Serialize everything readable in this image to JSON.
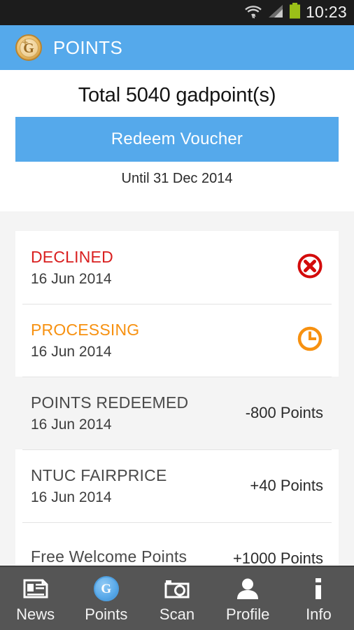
{
  "statusbar": {
    "time": "10:23",
    "icons": [
      "wifi-icon",
      "cellular-signal-icon",
      "battery-icon"
    ]
  },
  "appbar": {
    "logo_icon": "gadpoint-coin-logo",
    "logo_letter": "G",
    "title": "POINTS",
    "background_color": "#55a9eb"
  },
  "summary": {
    "total_label": "Total 5040 gadpoint(s)",
    "redeem_button_label": "Redeem Voucher",
    "validity_label": "Until 31 Dec 2014"
  },
  "transactions": [
    {
      "title": "DECLINED",
      "date": "16 Jun 2014",
      "amount": "",
      "status": "declined",
      "icon": "circle-x-icon",
      "icon_color": "#d30b0b",
      "title_color": "#d91f1f",
      "pressed": false
    },
    {
      "title": "PROCESSING",
      "date": "16 Jun 2014",
      "amount": "",
      "status": "processing",
      "icon": "clock-icon",
      "icon_color": "#f79110",
      "title_color": "#f79110",
      "pressed": false
    },
    {
      "title": "POINTS REDEEMED",
      "date": "16 Jun 2014",
      "amount": "-800 Points",
      "status": "redeemed",
      "icon": "",
      "icon_color": "",
      "title_color": "#4a4a4a",
      "pressed": true
    },
    {
      "title": "NTUC FAIRPRICE",
      "date": "16 Jun 2014",
      "amount": "+40 Points",
      "status": "earned",
      "icon": "",
      "icon_color": "",
      "title_color": "#4a4a4a",
      "pressed": false
    },
    {
      "title": "Free Welcome Points",
      "date": "",
      "amount": "+1000 Points",
      "status": "earned",
      "icon": "",
      "icon_color": "",
      "title_color": "#4a4a4a",
      "pressed": false
    }
  ],
  "navbar": {
    "background_color": "#555555",
    "items": [
      {
        "label": "News",
        "icon": "newspaper-icon",
        "active": false
      },
      {
        "label": "Points",
        "icon": "coin-icon",
        "active": true
      },
      {
        "label": "Scan",
        "icon": "camera-icon",
        "active": false
      },
      {
        "label": "Profile",
        "icon": "person-icon",
        "active": false
      },
      {
        "label": "Info",
        "icon": "info-icon",
        "active": false
      }
    ]
  }
}
